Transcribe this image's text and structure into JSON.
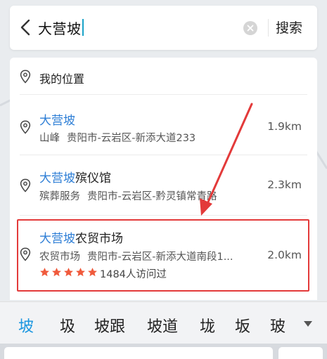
{
  "search": {
    "query": "大营坡",
    "search_label": "搜索"
  },
  "my_location": {
    "label": "我的位置"
  },
  "results": [
    {
      "name_highlight": "大营坡",
      "name_rest": "",
      "category": "山峰",
      "address": "贵阳市-云岩区-新添大道233",
      "distance": "1.9km"
    },
    {
      "name_highlight": "大营坡",
      "name_rest": "殡仪馆",
      "category": "殡葬服务",
      "address": "贵阳市-云岩区-黔灵镇常青路",
      "distance": "2.3km"
    },
    {
      "name_highlight": "大营坡",
      "name_rest": "农贸市场",
      "category": "农贸市场",
      "address": "贵阳市-云岩区-新添大道南段1...",
      "distance": "2.0km",
      "rating": 5,
      "visits": "1484人访问过"
    }
  ],
  "candidates": [
    "坡",
    "圾",
    "坡跟",
    "坡道",
    "垅",
    "坂",
    "玻"
  ],
  "colors": {
    "highlight_text": "#2f7fd6",
    "annotation_red": "#e33a3a",
    "star": "#f05a3c",
    "candidate_active": "#1a96e0"
  }
}
